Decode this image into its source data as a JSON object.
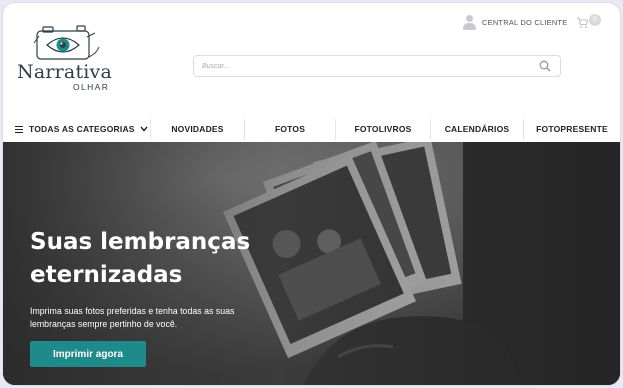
{
  "brand": {
    "name": "Narrativa",
    "subtitle": "OLHAR",
    "color": "#2f3e46",
    "accent": "#1e8a8a"
  },
  "header": {
    "customer_area_label": "CENTRAL DO CLIENTE",
    "customer_icon": "user-icon",
    "cart_icon": "cart-icon",
    "cart_count": "0",
    "search": {
      "placeholder": "Buscar...",
      "icon": "search-icon"
    }
  },
  "nav": {
    "all_categories_label": "TODAS AS CATEGORIAS",
    "items": [
      {
        "label": "NOVIDADES"
      },
      {
        "label": "FOTOS"
      },
      {
        "label": "FOTOLIVROS"
      },
      {
        "label": "CALENDÁRIOS"
      },
      {
        "label": "FOTOPRESENTE"
      }
    ]
  },
  "hero": {
    "title_line1": "Suas lembranças",
    "title_line2": "eternizadas",
    "description": "Imprima suas fotos preferidas e tenha todas as suas lembranças sempre pertinho de você.",
    "cta_label": "Imprimir agora",
    "cta_color": "#1e8a8a"
  }
}
